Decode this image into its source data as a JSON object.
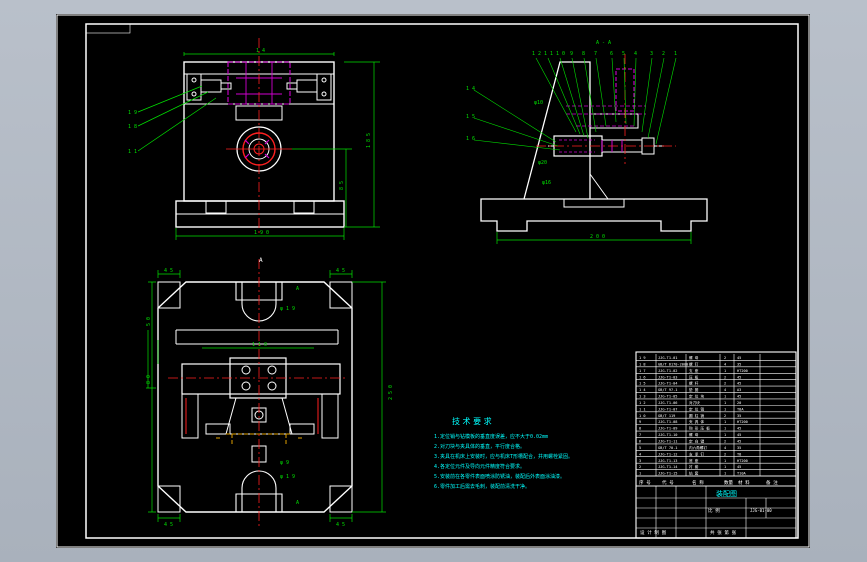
{
  "colors": {
    "canvas_bg": "#000000",
    "workspace_bg": "#b3bac4",
    "outline": "#ffffff",
    "dimension": "#00e000",
    "center_line": "#ff2020",
    "hidden_part": "#d000d0",
    "leader": "#00e000",
    "tech_text": "#00ffff",
    "table_text": "#ffffff"
  },
  "drawing": {
    "front_view": {
      "top_dim": "1 4",
      "height_dim": "1 8 5",
      "mid_dim": "8 5",
      "bottom_dim": "1 9 0",
      "part_labels": [
        "1 9",
        "1 8",
        "1 1"
      ]
    },
    "side_view": {
      "section_label": "A - A",
      "top_labels": [
        "1 2",
        "1 1",
        "1 0",
        "9",
        "8",
        "7",
        "6",
        "5",
        "4",
        "3",
        "2",
        "1"
      ],
      "left_labels": [
        "1 4",
        "1 5",
        "1 6"
      ],
      "bottom_dim": "2 0 0",
      "note_labels": [
        "φ10",
        "φ20",
        "φ16"
      ]
    },
    "top_view": {
      "view_marker": "A",
      "corner_dims": [
        "4 5",
        "4 5",
        "4 5",
        "4 5"
      ],
      "width_dim": "1 1 0",
      "height_dim": "2 5 0",
      "left_dims": [
        "5 0",
        "8 0"
      ],
      "hole_labels": [
        "φ 1 9",
        "φ 1 9",
        "φ 9"
      ],
      "side_marks": [
        "A",
        "A"
      ]
    }
  },
  "tech_requirements": {
    "title": "技 术 要 求",
    "lines": [
      "1.定位销与钻模板的垂直度误差，应不大于0.02mm",
      "2.对刀块与夹具体的垂直，平行度合格。",
      "3.夹具在机床上安装时，应与机床T形槽配合，并用螺栓紧固。",
      "4.各定位元件及导向元件精度符合要求。",
      "5.安装前在各零件表面喷涂防锈油，装配后外表面涂油漆。",
      "6.零件加工后需去毛刺，装配前清洗干净。"
    ]
  },
  "title_block": {
    "parts_rows": [
      {
        "no": "1 9",
        "code": "JJG-T1-01",
        "name": "螺 母",
        "qty": "2",
        "mat": "45"
      },
      {
        "no": "1 8",
        "code": "GB/T 6170-2000",
        "name": "螺 钉",
        "qty": "4",
        "mat": "35"
      },
      {
        "no": "1 7",
        "code": "JJG-T1-02",
        "name": "支 座",
        "qty": "1",
        "mat": "HT200"
      },
      {
        "no": "1 6",
        "code": "JJG-T1-03",
        "name": "压 板",
        "qty": "2",
        "mat": "45"
      },
      {
        "no": "1 5",
        "code": "JJG-T1-04",
        "name": "螺 杆",
        "qty": "2",
        "mat": "45"
      },
      {
        "no": "1 4",
        "code": "GB/T 97.1",
        "name": "垫 圈",
        "qty": "4",
        "mat": "A3"
      },
      {
        "no": "1 3",
        "code": "JJG-T1-05",
        "name": "定 位 块",
        "qty": "1",
        "mat": "45"
      },
      {
        "no": "1 2",
        "code": "JJG-T1-06",
        "name": "对刀块",
        "qty": "1",
        "mat": "20"
      },
      {
        "no": "1 1",
        "code": "JJG-T1-07",
        "name": "定 位 销",
        "qty": "1",
        "mat": "T8A"
      },
      {
        "no": "1 0",
        "code": "GB/T 119",
        "name": "圆 柱 销",
        "qty": "2",
        "mat": "35"
      },
      {
        "no": "9",
        "code": "JJG-T1-08",
        "name": "夹 具 体",
        "qty": "1",
        "mat": "HT200"
      },
      {
        "no": "8",
        "code": "JJG-T1-09",
        "name": "钩 形 压 板",
        "qty": "1",
        "mat": "45"
      },
      {
        "no": "7",
        "code": "JJG-T1-10",
        "name": "螺 母",
        "qty": "1",
        "mat": "45"
      },
      {
        "no": "6",
        "code": "JJG-T1-11",
        "name": "定 向 键",
        "qty": "2",
        "mat": "45"
      },
      {
        "no": "5",
        "code": "GB/T 70.1",
        "name": "内六角螺钉",
        "qty": "4",
        "mat": "35"
      },
      {
        "no": "4",
        "code": "JJG-T1-12",
        "name": "支 承 钉",
        "qty": "2",
        "mat": "T8"
      },
      {
        "no": "3",
        "code": "JJG-T1-13",
        "name": "底 座",
        "qty": "1",
        "mat": "HT200"
      },
      {
        "no": "2",
        "code": "JJG-T1-14",
        "name": "衬 套",
        "qty": "1",
        "mat": "45"
      },
      {
        "no": "1",
        "code": "JJG-T1-15",
        "name": "钻 套",
        "qty": "1",
        "mat": "T10A"
      }
    ],
    "header": [
      "序 号",
      "代 号",
      "名 称",
      "数量",
      "材 料",
      "备 注"
    ],
    "assembly_name": "装配图",
    "drawing_no": "JJG-01-00",
    "scale_label": "比 例",
    "sheet_label": "共 张 第 张",
    "school_label": "设 计 制 图"
  }
}
